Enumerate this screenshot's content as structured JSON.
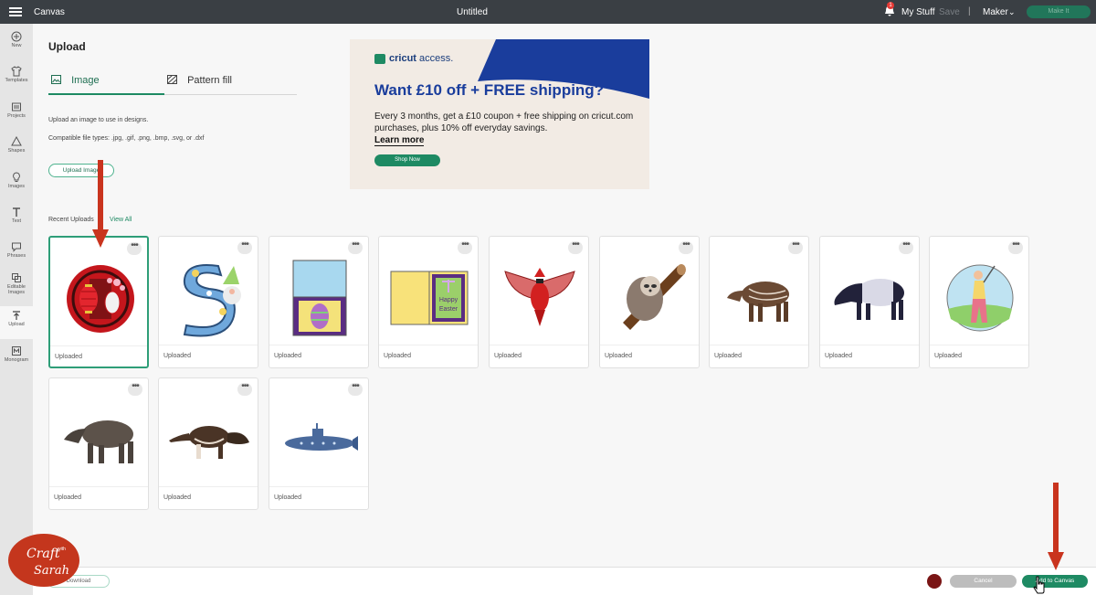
{
  "topbar": {
    "app_title": "Canvas",
    "doc_title": "Untitled",
    "notification_count": "1",
    "my_stuff": "My Stuff",
    "save": "Save",
    "separator": "|",
    "machine": "Maker",
    "make_it": "Make It"
  },
  "rail": [
    {
      "label": "New",
      "icon": "plus-circle-icon"
    },
    {
      "label": "Templates",
      "icon": "shirt-icon"
    },
    {
      "label": "Projects",
      "icon": "projects-icon"
    },
    {
      "label": "Shapes",
      "icon": "shapes-icon"
    },
    {
      "label": "Images",
      "icon": "lightbulb-icon"
    },
    {
      "label": "Text",
      "icon": "text-icon"
    },
    {
      "label": "Phrases",
      "icon": "speech-bubble-icon"
    },
    {
      "label": "Editable Images",
      "icon": "editable-images-icon"
    },
    {
      "label": "Upload",
      "icon": "upload-icon"
    },
    {
      "label": "Monogram",
      "icon": "monogram-icon"
    }
  ],
  "upload": {
    "title": "Upload",
    "tabs": [
      {
        "label": "Image",
        "icon": "image-icon",
        "active": true
      },
      {
        "label": "Pattern fill",
        "icon": "pattern-icon",
        "active": false
      }
    ],
    "description": "Upload an image to use in designs.",
    "file_types": "Compatible file types: .jpg, .gif, .png, .bmp, .svg, or .dxf",
    "upload_button": "Upload Image"
  },
  "ad": {
    "logo_bold": "cricut",
    "logo_light": "access.",
    "headline": "Want £10 off + FREE shipping?",
    "body": "Every 3 months, get a £10 coupon + free shipping on cricut.com purchases, plus 10% off everyday savings.",
    "learn_more": "Learn more",
    "shop_now": "Shop Now",
    "colors": {
      "background": "#f2ebe4",
      "accent": "#1a3d9c",
      "green": "#1e8a63"
    }
  },
  "recent": {
    "label": "Recent Uploads",
    "view_all": "View All",
    "items": [
      {
        "caption": "Uploaded",
        "art": "chinese-lanterns",
        "selected": true
      },
      {
        "caption": "Uploaded",
        "art": "letter-s-gnome",
        "selected": false
      },
      {
        "caption": "Uploaded",
        "art": "easter-card-blue",
        "selected": false
      },
      {
        "caption": "Uploaded",
        "art": "happy-easter-card",
        "selected": false
      },
      {
        "caption": "Uploaded",
        "art": "red-cardinal",
        "selected": false
      },
      {
        "caption": "Uploaded",
        "art": "sloth",
        "selected": false
      },
      {
        "caption": "Uploaded",
        "art": "baby-tapir",
        "selected": false
      },
      {
        "caption": "Uploaded",
        "art": "malayan-tapir",
        "selected": false
      },
      {
        "caption": "Uploaded",
        "art": "golfer",
        "selected": false
      },
      {
        "caption": "Uploaded",
        "art": "tapir",
        "selected": false
      },
      {
        "caption": "Uploaded",
        "art": "anteater",
        "selected": false
      },
      {
        "caption": "Uploaded",
        "art": "submarine",
        "selected": false
      }
    ],
    "card_menu": "•••",
    "easter_card_text": [
      "Happy",
      "Easter"
    ]
  },
  "bottombar": {
    "download": "Download",
    "cancel": "Cancel",
    "add_to_canvas": "Add to Canvas"
  },
  "watermark": {
    "line1": "Craft",
    "line2": "with",
    "line3": "Sarah"
  }
}
